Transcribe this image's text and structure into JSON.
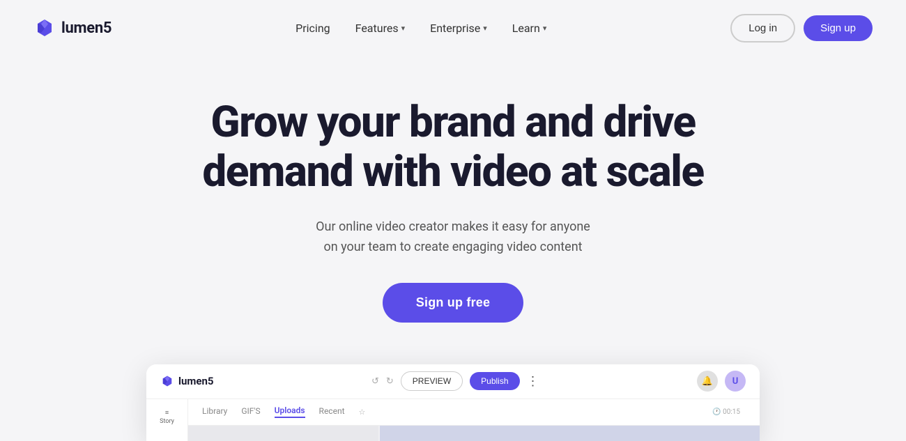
{
  "brand": {
    "name": "lumen5",
    "logo_color": "#5b4de8"
  },
  "nav": {
    "links": [
      {
        "id": "pricing",
        "label": "Pricing",
        "has_dropdown": false
      },
      {
        "id": "features",
        "label": "Features",
        "has_dropdown": true
      },
      {
        "id": "enterprise",
        "label": "Enterprise",
        "has_dropdown": true
      },
      {
        "id": "learn",
        "label": "Learn",
        "has_dropdown": true
      }
    ],
    "login_label": "Log in",
    "signup_label": "Sign up"
  },
  "hero": {
    "title_line1": "Grow your brand and drive",
    "title_line2": "demand with video at scale",
    "subtitle_line1": "Our online video creator makes it easy for anyone",
    "subtitle_line2": "on your team to create engaging video content",
    "cta_label": "Sign up free"
  },
  "app_preview": {
    "logo_text": "lumen5",
    "btn_preview": "PREVIEW",
    "btn_publish": "Publish",
    "tabs": [
      {
        "id": "library",
        "label": "Library",
        "active": false
      },
      {
        "id": "gifs",
        "label": "GIF'S",
        "active": false
      },
      {
        "id": "uploads",
        "label": "Uploads",
        "active": true
      },
      {
        "id": "recent",
        "label": "Recent",
        "active": false
      }
    ],
    "timestamp": "00:15",
    "sidebar_label": "Story"
  },
  "colors": {
    "accent": "#5b4de8",
    "bg": "#f5f5f7",
    "text_dark": "#1a1a2e",
    "text_mid": "#555555"
  }
}
